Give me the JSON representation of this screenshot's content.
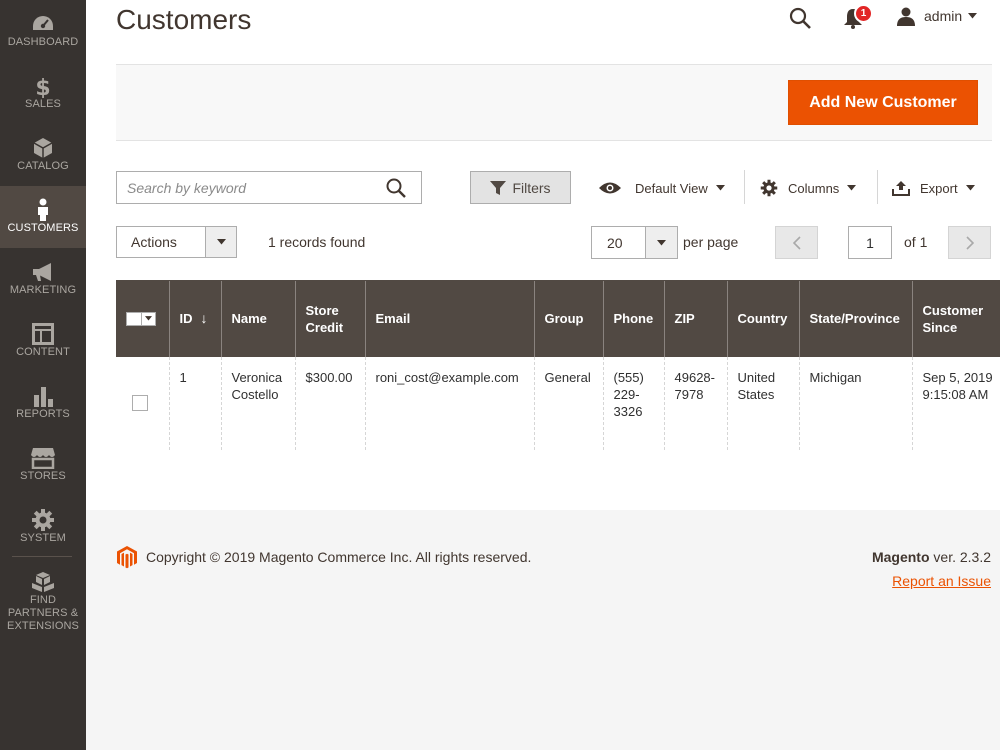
{
  "sidebar": {
    "items": [
      {
        "label": "DASHBOARD",
        "icon": "dashboard-icon"
      },
      {
        "label": "SALES",
        "icon": "dollar-icon"
      },
      {
        "label": "CATALOG",
        "icon": "cube-icon"
      },
      {
        "label": "CUSTOMERS",
        "icon": "person-icon",
        "active": true
      },
      {
        "label": "MARKETING",
        "icon": "megaphone-icon"
      },
      {
        "label": "CONTENT",
        "icon": "layout-icon"
      },
      {
        "label": "REPORTS",
        "icon": "bar-chart-icon"
      },
      {
        "label": "STORES",
        "icon": "storefront-icon"
      },
      {
        "label": "SYSTEM",
        "icon": "gear-icon"
      },
      {
        "label": "FIND PARTNERS & EXTENSIONS",
        "icon": "boxes-icon"
      }
    ]
  },
  "header": {
    "title": "Customers",
    "notification_count": "1",
    "user_name": "admin"
  },
  "action_bar": {
    "add_button": "Add New Customer"
  },
  "toolbar": {
    "search_placeholder": "Search by keyword",
    "filters_label": "Filters",
    "view_label": "Default View",
    "columns_label": "Columns",
    "export_label": "Export",
    "actions_label": "Actions",
    "records_found": "1 records found",
    "per_page_value": "20",
    "per_page_label": "per page",
    "current_page": "1",
    "page_of": "of 1"
  },
  "grid": {
    "columns": [
      "ID",
      "Name",
      "Store Credit",
      "Email",
      "Group",
      "Phone",
      "ZIP",
      "Country",
      "State/Province",
      "Customer Since"
    ],
    "sort_indicator": "↓",
    "rows": [
      {
        "id": "1",
        "name": "Veronica Costello",
        "store_credit": "$300.00",
        "email": "roni_cost@example.com",
        "group": "General",
        "phone": "(555) 229-3326",
        "zip": "49628-7978",
        "country": "United States",
        "state": "Michigan",
        "customer_since": "Sep 5, 2019 9:15:08 AM"
      }
    ]
  },
  "footer": {
    "copyright": "Copyright © 2019 Magento Commerce Inc. All rights reserved.",
    "brand": "Magento",
    "version": "ver. 2.3.2",
    "report_link": "Report an Issue"
  },
  "colors": {
    "accent": "#eb5202",
    "sidebar_bg": "#373330",
    "sidebar_active": "#514943",
    "table_header": "#514943",
    "badge": "#e22626"
  }
}
